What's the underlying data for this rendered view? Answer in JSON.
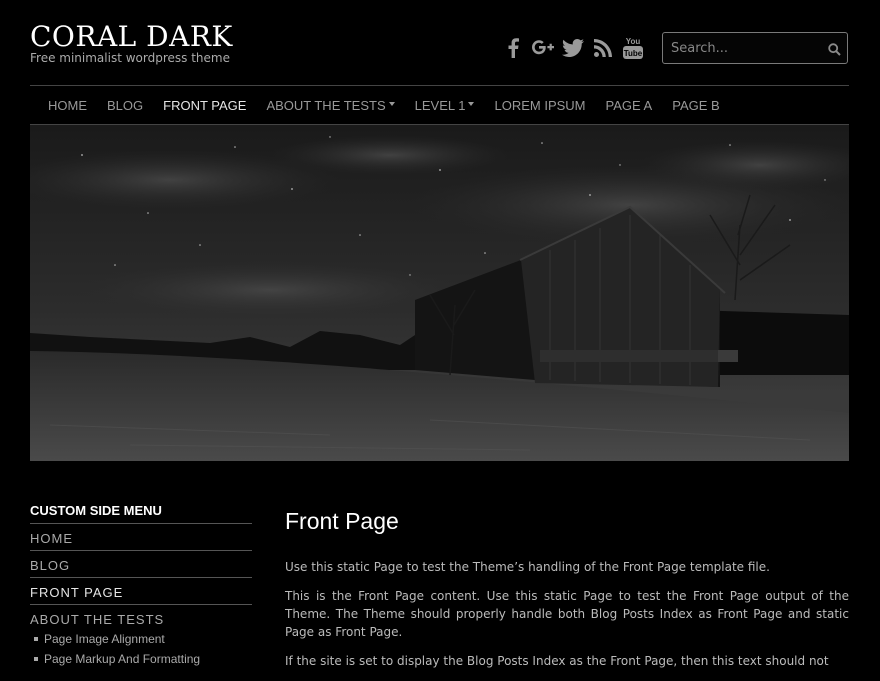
{
  "header": {
    "site_title": "CORAL DARK",
    "tagline": "Free minimalist wordpress theme",
    "social_icons": [
      "facebook-icon",
      "google-plus-icon",
      "twitter-icon",
      "rss-icon",
      "youtube-icon"
    ],
    "search_placeholder": "Search..."
  },
  "nav": {
    "items": [
      {
        "label": "HOME",
        "active": false,
        "dropdown": false
      },
      {
        "label": "BLOG",
        "active": false,
        "dropdown": false
      },
      {
        "label": "FRONT PAGE",
        "active": true,
        "dropdown": false
      },
      {
        "label": "ABOUT THE TESTS",
        "active": false,
        "dropdown": true
      },
      {
        "label": "LEVEL 1",
        "active": false,
        "dropdown": true
      },
      {
        "label": "LOREM IPSUM",
        "active": false,
        "dropdown": false
      },
      {
        "label": "PAGE A",
        "active": false,
        "dropdown": false
      },
      {
        "label": "PAGE B",
        "active": false,
        "dropdown": false
      }
    ]
  },
  "sidebar": {
    "title": "CUSTOM SIDE MENU",
    "items": [
      {
        "label": "HOME"
      },
      {
        "label": "BLOG"
      },
      {
        "label": "FRONT PAGE"
      },
      {
        "label": "ABOUT THE TESTS"
      }
    ],
    "sub_items": [
      {
        "label": "Page Image Alignment"
      },
      {
        "label": "Page Markup And Formatting"
      }
    ]
  },
  "content": {
    "title": "Front Page",
    "paragraphs": [
      "Use this static Page to test the Theme’s handling of the Front Page template file.",
      "This is the Front Page content. Use this static Page to test the Front Page output of the Theme. The Theme should properly handle both Blog Posts Index as Front Page and static Page as Front Page.",
      "If the site is set to display the Blog Posts Index as the Front Page, then this text should not"
    ]
  },
  "colors": {
    "background": "#000000",
    "title": "#ffffff",
    "nav_text": "#999999",
    "nav_active": "#e6e6e6",
    "rule": "#444444"
  }
}
